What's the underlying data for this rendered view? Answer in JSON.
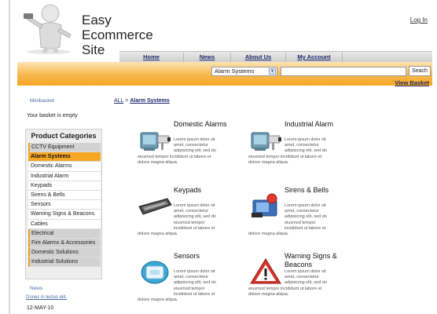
{
  "site": {
    "logo_lines": [
      "Easy",
      "Ecommerce",
      "Site"
    ],
    "login_label": "Log In"
  },
  "nav": {
    "items": [
      "Home",
      "News",
      "About Us",
      "My Account"
    ]
  },
  "search": {
    "category_value": "Alarm Systems",
    "query_value": "",
    "button_label": "Seach",
    "view_basket_label": "View Basket"
  },
  "sidebar": {
    "minibasket_label": "Minibasket",
    "basket_status": "Your basket is empty",
    "categories_title": "Product Categories",
    "categories": [
      {
        "label": "CCTV Equipment",
        "style": "shaded"
      },
      {
        "label": "Alarm Systems",
        "style": "active"
      },
      {
        "label": "Domestic Alarms",
        "style": "plain"
      },
      {
        "label": "Industrial Alarm",
        "style": "plain"
      },
      {
        "label": "Keypads",
        "style": "plain"
      },
      {
        "label": "Sirens & Bells",
        "style": "plain"
      },
      {
        "label": "Sensors",
        "style": "plain"
      },
      {
        "label": "Warning Signs & Beacons",
        "style": "plain"
      },
      {
        "label": "Cables",
        "style": "plain"
      },
      {
        "label": "Electrical",
        "style": "shaded"
      },
      {
        "label": "Fire Alarms & Accessories",
        "style": "shaded"
      },
      {
        "label": "Domestic Solutions",
        "style": "shaded"
      },
      {
        "label": "Industrial Solutions",
        "style": "shaded"
      }
    ],
    "news_label": "News",
    "news_link": "Donec in lectus elit.",
    "date": "12-MAY-10"
  },
  "breadcrumb": {
    "root": "ALL",
    "separator": ">",
    "current": "Alarm Systems"
  },
  "products": [
    {
      "name": "Domestic Alarms",
      "icon": "cctv-camera-icon",
      "desc_side": [
        "Lorem ipsum dolor sit",
        "amet, consectetur",
        "adipisicing elit, sed do"
      ],
      "desc_full": [
        "eiusmod tempor incididunt ut labore et",
        "dolore magna aliqua."
      ]
    },
    {
      "name": "Industrial Alarm",
      "icon": "cctv-camera-icon",
      "desc_side": [
        "Lorem ipsum dolor sit",
        "amet, consectetur",
        "adipisicing elit, sed do"
      ],
      "desc_full": [
        "eiusmod tempor incididunt ut labore et",
        "dolore magna aliqua."
      ]
    },
    {
      "name": "Keypads",
      "icon": "keyboard-icon",
      "desc_side": [
        "Lorem ipsum dolor sit",
        "amet, consectetur",
        "adipisicing elit, sed do",
        "eiusmod tempor",
        "incididunt ut labore et"
      ],
      "desc_full": [
        "dolore magna aliqua."
      ]
    },
    {
      "name": "Sirens & Bells",
      "icon": "siren-icon",
      "desc_side": [
        "Lorem ipsum dolor sit",
        "amet, consectetur",
        "adipisicing elit, sed do",
        "eiusmod tempor",
        "incididunt ut labore et"
      ],
      "desc_full": [
        "dolore magna aliqua."
      ]
    },
    {
      "name": "Sensors",
      "icon": "sensor-icon",
      "desc_side": [
        "Lorem ipsum dolor sit",
        "amet, consectetur",
        "adipisicing elit, sed do",
        "eiusmod tempor",
        "incididunt ut labore et"
      ],
      "desc_full": [
        "dolore magna aliqua."
      ]
    },
    {
      "name": "Warning Signs & Beacons",
      "icon": "warning-sign-icon",
      "desc_side": [
        "Lorem ipsum dolor sit",
        "amet, consectetur",
        "adipisicing elit, sed do"
      ],
      "desc_full": [
        "eiusmod tempor incididunt ut labore et",
        "dolore magna aliqua."
      ]
    }
  ],
  "colors": {
    "accent": "#f6a623",
    "link": "#1c2a6b",
    "panel": "#eeeeee"
  }
}
